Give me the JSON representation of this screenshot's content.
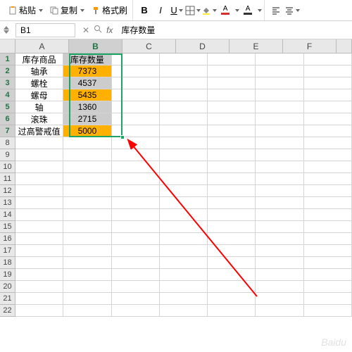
{
  "toolbar": {
    "paste": "粘贴",
    "copy": "复制",
    "format_painter": "格式刷",
    "bold": "B",
    "italic": "I",
    "underline": "U",
    "font_color_letter": "A",
    "fill_color_letter": "A"
  },
  "namebox": {
    "cell_ref": "B1",
    "fx": "fx",
    "formula_value": "库存数量"
  },
  "columns": [
    "A",
    "B",
    "C",
    "D",
    "E",
    "F"
  ],
  "selected_col": "B",
  "rows_visible": 22,
  "selected_rows": [
    1,
    2,
    3,
    4,
    5,
    6,
    7
  ],
  "table": {
    "header_a": "库存商品",
    "header_b": "库存数量",
    "data": [
      {
        "a": "轴承",
        "b": "7373",
        "hl": true
      },
      {
        "a": "螺栓",
        "b": "4537",
        "hl": false
      },
      {
        "a": "螺母",
        "b": "5435",
        "hl": true
      },
      {
        "a": "轴",
        "b": "1360",
        "hl": false
      },
      {
        "a": "滚珠",
        "b": "2715",
        "hl": false
      },
      {
        "a": "过高警戒值",
        "b": "5000",
        "hl": true
      }
    ]
  },
  "watermark": {
    "main": "Baidu",
    "sub": ""
  }
}
